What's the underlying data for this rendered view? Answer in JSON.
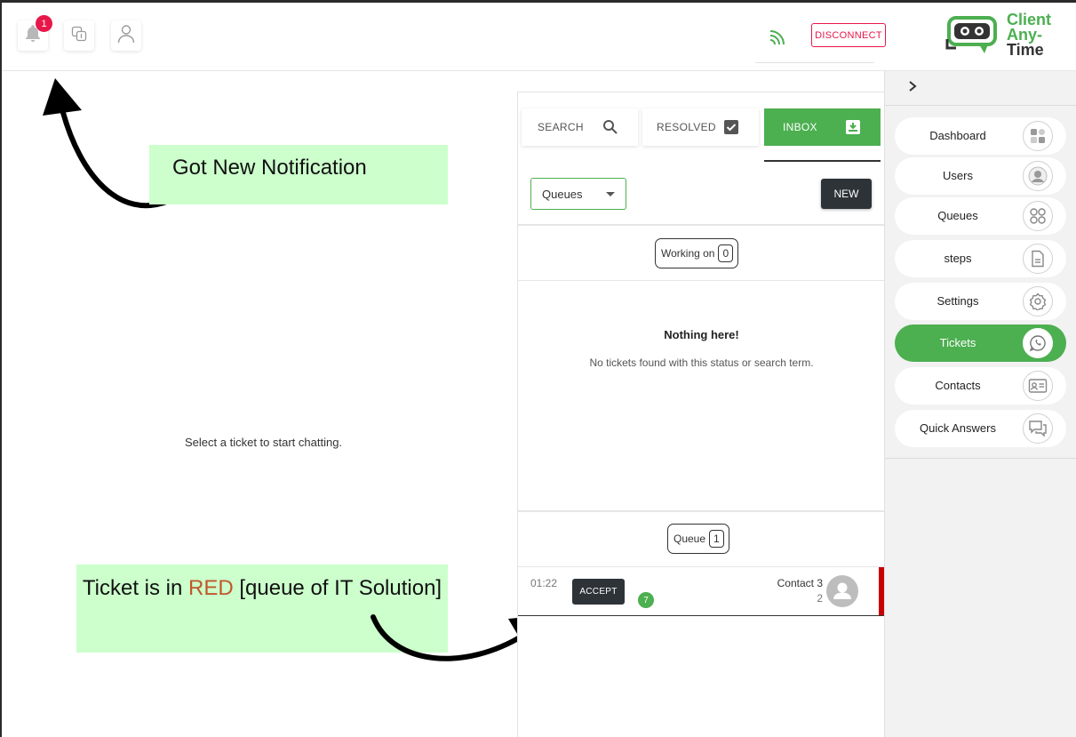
{
  "topbar": {
    "notification_count": "1",
    "disconnect_label": "DISCONNECT",
    "logo": {
      "line1": "Client",
      "line2": "Any-",
      "line3": "Time"
    },
    "icons": [
      "bell-icon",
      "queue-icon",
      "user-icon",
      "wifi-icon"
    ]
  },
  "chat": {
    "empty_message": "Select a ticket to start chatting."
  },
  "annotations": {
    "note1": "Got New Notification",
    "note2_prefix": "Ticket is in ",
    "note2_highlight": "RED",
    "note2_suffix": " [queue of IT Solution]",
    "highlight_color": "#c0582c",
    "note_bg": "#ccffcc"
  },
  "tickets_panel": {
    "tabs": {
      "search": "SEARCH",
      "resolved": "RESOLVED",
      "inbox": "INBOX"
    },
    "queues_select": "Queues",
    "new_button": "NEW",
    "working_on": {
      "label": "Working on",
      "count": "0"
    },
    "empty": {
      "title": "Nothing here!",
      "subtitle": "No tickets found with this status or search term."
    },
    "queue": {
      "label": "Queue",
      "count": "1"
    },
    "ticket": {
      "time": "01:22",
      "accept_label": "ACCEPT",
      "badge": "7",
      "contact_name": "Contact 3",
      "contact_number": "2",
      "queue_color": "#c80000"
    }
  },
  "sidebar": {
    "items": [
      {
        "label": "Dashboard",
        "icon": "dashboard-icon"
      },
      {
        "label": "Users",
        "icon": "users-icon"
      },
      {
        "label": "Queues",
        "icon": "queues-icon"
      },
      {
        "label": "steps",
        "icon": "steps-icon"
      },
      {
        "label": "Settings",
        "icon": "settings-icon"
      },
      {
        "label": "Tickets",
        "icon": "tickets-icon",
        "active": true
      },
      {
        "label": "Contacts",
        "icon": "contacts-icon"
      },
      {
        "label": "Quick Answers",
        "icon": "quick-answers-icon"
      }
    ]
  },
  "colors": {
    "accent": "#4caf50",
    "danger": "#e8174a",
    "dark_button": "#2e3338"
  }
}
